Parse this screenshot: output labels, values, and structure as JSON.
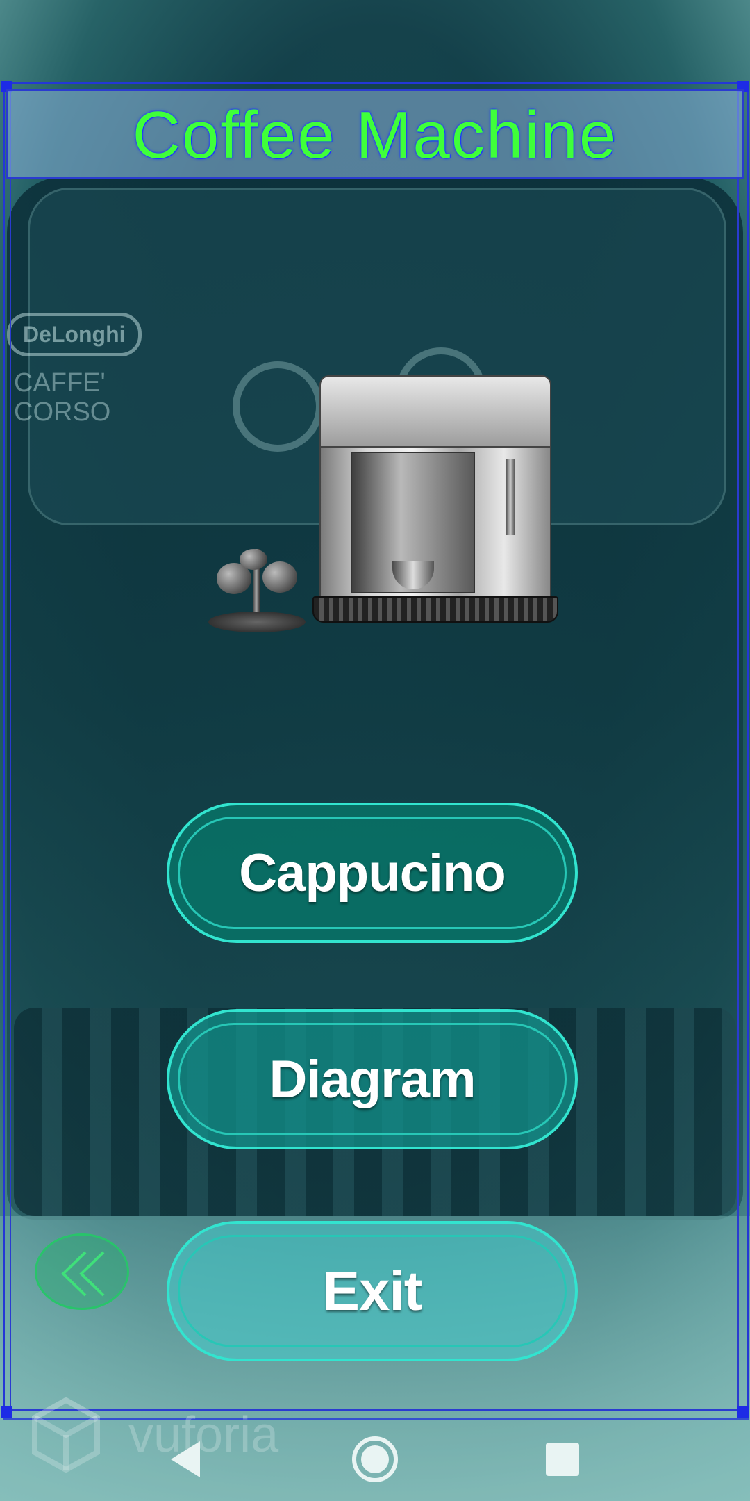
{
  "app": {
    "title": "Coffee Machine"
  },
  "buttons": {
    "cappuccino_label": "Cappucino",
    "diagram_label": "Diagram",
    "exit_label": "Exit"
  },
  "background": {
    "logo_text": "DeLonghi",
    "logo_sub": "CAFFE' CORSO"
  },
  "watermark": {
    "text": "vuforia"
  },
  "colors": {
    "title_green": "#3fff3a",
    "button_border": "#32e4cf",
    "frame_blue": "#2437d6"
  },
  "icons": {
    "back": "double-chevron-left-icon",
    "nav_back": "triangle-back-icon",
    "nav_home": "circle-home-icon",
    "nav_recents": "square-recents-icon"
  }
}
